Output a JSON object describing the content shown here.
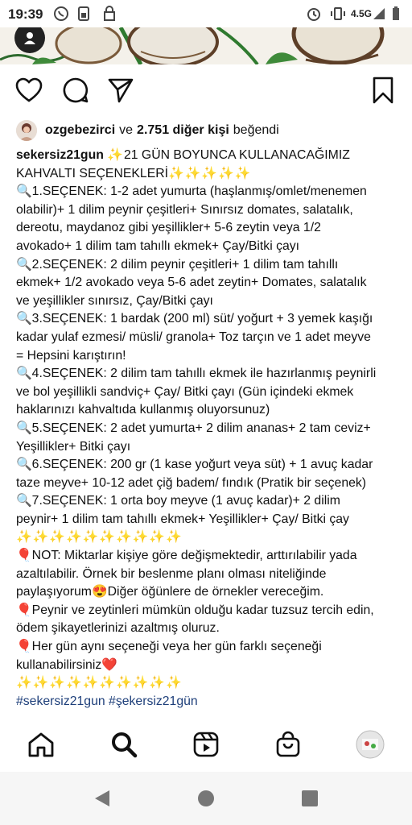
{
  "status_bar": {
    "time": "19:39",
    "network": "4.5G",
    "icons": [
      "whatsapp-icon",
      "sim-icon",
      "lock-icon",
      "alarm-icon",
      "vibrate-icon",
      "signal-icon",
      "battery-icon"
    ]
  },
  "post_actions": {
    "icons": [
      "heart-icon",
      "comment-icon",
      "share-icon",
      "bookmark-icon"
    ]
  },
  "likes": {
    "user": "ozgebezirci",
    "connector": "ve",
    "others": "2.751 diğer kişi",
    "suffix": "beğendi"
  },
  "caption": {
    "username": "sekersiz21gun",
    "lines": [
      {
        "icon": "sparkle",
        "text": "21 GÜN BOYUNCA KULLANACAĞIMIZ"
      },
      {
        "text": "KAHVALTI SEÇENEKLERİ",
        "trail": "✨✨✨✨✨"
      },
      {
        "icon": "magnifier",
        "text": "1.SEÇENEK: 1-2 adet yumurta (haşlanmış/omlet/menemen"
      },
      {
        "text": "olabilir)+ 1 dilim peynir çeşitleri+ Sınırsız domates, salatalık,"
      },
      {
        "text": "dereotu, maydanoz gibi yeşillikler+ 5-6 zeytin veya 1/2"
      },
      {
        "text": "avokado+ 1 dilim tam tahıllı ekmek+ Çay/Bitki çayı"
      },
      {
        "icon": "magnifier",
        "text": "2.SEÇENEK: 2 dilim peynir çeşitleri+ 1 dilim tam tahıllı"
      },
      {
        "text": "ekmek+ 1/2 avokado veya 5-6 adet zeytin+ Domates, salatalık"
      },
      {
        "text": "ve yeşillikler sınırsız, Çay/Bitki çayı"
      },
      {
        "icon": "magnifier",
        "text": "3.SEÇENEK: 1 bardak (200 ml) süt/ yoğurt + 3 yemek kaşığı"
      },
      {
        "text": "kadar yulaf ezmesi/ müsli/ granola+ Toz tarçın ve 1 adet meyve"
      },
      {
        "text": "= Hepsini karıştırın!"
      },
      {
        "icon": "magnifier",
        "text": "4.SEÇENEK: 2 dilim tam tahıllı ekmek ile hazırlanmış peynirli"
      },
      {
        "text": "ve bol yeşillikli sandviç+ Çay/ Bitki çayı (Gün içindeki ekmek"
      },
      {
        "text": "haklarınızı kahvaltıda kullanmış oluyorsunuz)"
      },
      {
        "icon": "magnifier",
        "text": "5.SEÇENEK: 2 adet yumurta+ 2 dilim ananas+ 2 tam ceviz+"
      },
      {
        "text": "Yeşillikler+ Bitki çayı"
      },
      {
        "icon": "magnifier",
        "text": "6.SEÇENEK: 200 gr (1 kase yoğurt veya süt) + 1 avuç kadar"
      },
      {
        "text": "taze meyve+ 10-12 adet çiğ badem/ fındık (Pratik bir seçenek)"
      },
      {
        "icon": "magnifier",
        "text": "7.SEÇENEK: 1 orta boy meyve (1 avuç kadar)+ 2 dilim"
      },
      {
        "text": "peynir+ 1 dilim tam tahıllı ekmek+ Yeşillikler+ Çay/ Bitki çay"
      },
      {
        "sparkles": "✨✨✨✨✨✨✨✨✨✨"
      },
      {
        "icon": "balloon",
        "text": "NOT: Miktarlar kişiye göre değişmektedir, arttırılabilir yada"
      },
      {
        "text": "azaltılabilir. Örnek bir beslenme planı olması niteliğinde"
      },
      {
        "text": "paylaşıyorum",
        "emoji_after": "😍",
        "text2": "Diğer öğünlere de örnekler vereceğim."
      },
      {
        "icon": "balloon",
        "text": "Peynir ve zeytinleri mümkün olduğu kadar tuzsuz tercih edin,"
      },
      {
        "text": "ödem şikayetlerinizi azaltmış oluruz."
      },
      {
        "icon": "balloon",
        "text": "Her gün aynı seçeneği veya her gün farklı seçeneği"
      },
      {
        "text": "kullanabilirsiniz",
        "emoji_after": "❤️"
      },
      {
        "sparkles": "✨✨✨✨✨✨✨✨✨✨"
      }
    ],
    "hashtags": "#sekersiz21gun #şekersiz21gün"
  },
  "bottom_nav": {
    "icons": [
      "home-icon",
      "search-icon",
      "reels-icon",
      "shop-icon",
      "profile-avatar"
    ]
  },
  "system_nav": {
    "icons": [
      "back-icon",
      "home-circle-icon",
      "recents-icon"
    ]
  },
  "colors": {
    "hashtag": "#1e3f7a",
    "sparkle": "#e5b800",
    "magnifier": "#f0a030",
    "balloon": "#e04a2a"
  }
}
